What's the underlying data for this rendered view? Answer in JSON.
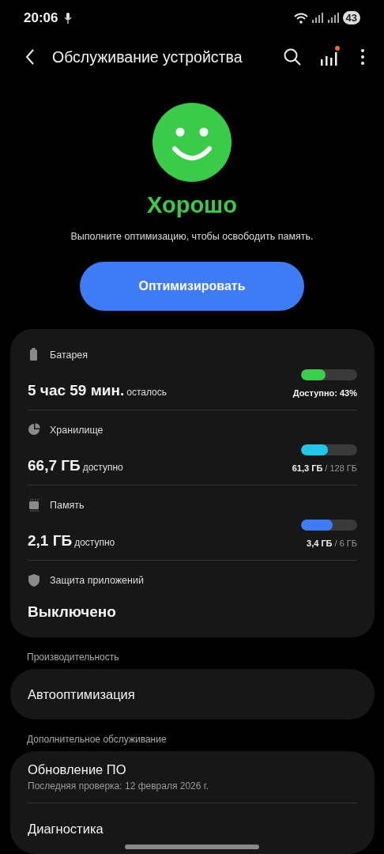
{
  "status_bar": {
    "time": "20:06",
    "battery": "43"
  },
  "header": {
    "title": "Обслуживание устройства",
    "notification_dot": true
  },
  "summary": {
    "status": "Хорошо",
    "message": "Выполните оптимизацию, чтобы освободить память.",
    "button": "Оптимизировать"
  },
  "stats": [
    {
      "kind": "meter",
      "label": "Батарея",
      "value": "5 час 59 мин.",
      "unit": "осталось",
      "level": 0.43,
      "color": "#3ccf4e",
      "reading": "Доступно: 43%"
    },
    {
      "kind": "meter",
      "label": "Хранилище",
      "value": "66,7 ГБ",
      "unit": "доступно",
      "level": 0.48,
      "color": "#1ec8e6",
      "reading": "61,3 ГБ",
      "reading_total": "/ 128 ГБ"
    },
    {
      "kind": "meter",
      "label": "Память",
      "value": "2,1 ГБ",
      "unit": "доступно",
      "level": 0.57,
      "color": "#3f7cf4",
      "reading": "3,4 ГБ",
      "reading_total": "/ 6 ГБ"
    },
    {
      "kind": "status",
      "label": "Защита приложений",
      "value": "Выключено"
    }
  ],
  "sections": [
    {
      "title": "Производительность",
      "items": [
        {
          "label": "Автооптимизация"
        }
      ]
    },
    {
      "title": "Дополнительное обслуживание",
      "items": [
        {
          "label": "Обновление ПО",
          "subtitle": "Последняя проверка: 12 февраля 2026 г."
        },
        {
          "label": "Диагностика"
        }
      ]
    }
  ]
}
